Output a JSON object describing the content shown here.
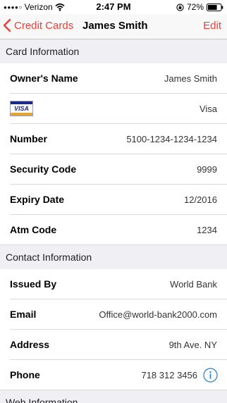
{
  "status_bar": {
    "signal": "●●●●○",
    "carrier": "Verizon",
    "time": "2:47 PM",
    "battery_percent": "72%",
    "battery_level": 0.72
  },
  "nav": {
    "back_label": "Credit Cards",
    "title": "James Smith",
    "edit_label": "Edit"
  },
  "sections": {
    "card_info": "Card Information",
    "contact_info": "Contact Information",
    "web_info": "Web Information"
  },
  "card": {
    "owner_label": "Owner's Name",
    "owner_value": "James Smith",
    "brand_logo_text": "VISA",
    "brand_value": "Visa",
    "number_label": "Number",
    "number_value": "5100-1234-1234-1234",
    "security_label": "Security Code",
    "security_value": "9999",
    "expiry_label": "Expiry Date",
    "expiry_value": "12/2016",
    "atm_label": "Atm Code",
    "atm_value": "1234"
  },
  "contact": {
    "issued_label": "Issued By",
    "issued_value": "World Bank",
    "email_label": "Email",
    "email_value": "Office@world-bank2000.com",
    "address_label": "Address",
    "address_value": "9th Ave. NY",
    "phone_label": "Phone",
    "phone_value": "718 312 3456"
  },
  "colors": {
    "accent": "#e8413a",
    "info_blue": "#1a7de0",
    "section_bg": "#efeff4",
    "visa_blue": "#1a2a8a",
    "visa_gold": "#e4a530"
  },
  "icons": {
    "back": "chevron-left-icon",
    "info": "info-circle-icon",
    "wifi": "wifi-icon",
    "rotation_lock": "rotation-lock-icon",
    "battery": "battery-icon",
    "card_brand": "visa-logo-icon"
  }
}
